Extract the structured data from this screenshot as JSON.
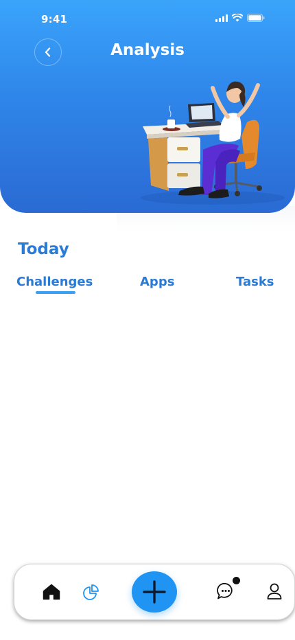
{
  "status_bar": {
    "time": "9:41"
  },
  "header": {
    "title": "Analysis"
  },
  "section": {
    "title": "Today"
  },
  "tabs": [
    {
      "label": "Challenges",
      "active": true
    },
    {
      "label": "Apps",
      "active": false
    },
    {
      "label": "Tasks",
      "active": false
    }
  ],
  "bottom_nav": {
    "items": [
      "home-icon",
      "analysis-icon",
      "add-icon",
      "messages-icon",
      "profile-icon"
    ],
    "active": "analysis",
    "messages_unread_dot": true
  },
  "colors": {
    "header_gradient_top": "#3aa4fb",
    "header_gradient_bottom": "#2a6ad3",
    "accent": "#2a7bd6",
    "fab": "#1f94f2"
  }
}
